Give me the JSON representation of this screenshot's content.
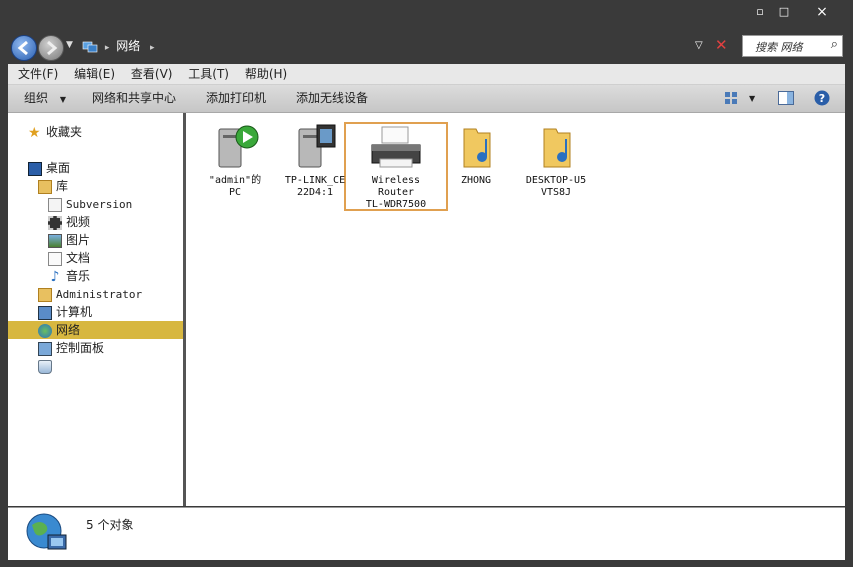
{
  "window": {
    "min": "▫",
    "max": "□",
    "close": "×"
  },
  "address": {
    "path": "网络"
  },
  "search": {
    "placeholder": "搜索 网络"
  },
  "menu": [
    {
      "label": "文件(F)"
    },
    {
      "label": "编辑(E)"
    },
    {
      "label": "查看(V)"
    },
    {
      "label": "工具(T)"
    },
    {
      "label": "帮助(H)"
    }
  ],
  "toolbar": {
    "organize": "组织",
    "network_center": "网络和共享中心",
    "add_printer": "添加打印机",
    "add_wireless": "添加无线设备"
  },
  "sidebar": {
    "favorites": "收藏夹",
    "desktop": "桌面",
    "library": "库",
    "subversion": "Subversion",
    "videos": "视频",
    "pictures": "图片",
    "documents": "文档",
    "music": "音乐",
    "administrator": "Administrator",
    "computer": "计算机",
    "network": "网络",
    "control_panel": "控制面板"
  },
  "items": [
    {
      "label": "\"admin\"的\nPC",
      "icon": "media-pc-icon"
    },
    {
      "label": "TP-LINK_CE\n22D4:1",
      "icon": "media-device-icon"
    },
    {
      "label": "Wireless\nRouter\nTL-WDR7500",
      "icon": "printer-icon"
    },
    {
      "label": "ZHONG",
      "icon": "music-folder-icon"
    },
    {
      "label": "DESKTOP-U5\nVTS8J",
      "icon": "music-folder-icon"
    }
  ],
  "status": {
    "text": "5 个对象"
  },
  "colors": {
    "selection": "#d7b740",
    "highlight_border": "#e0a050"
  }
}
